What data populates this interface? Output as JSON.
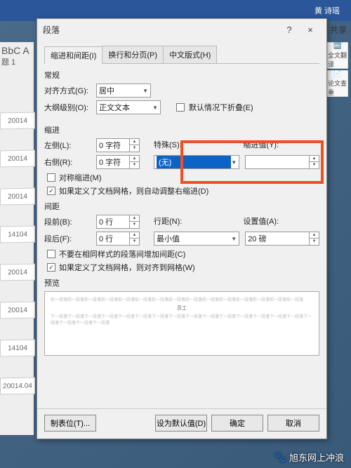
{
  "bg": {
    "user": "黄 诗瑶",
    "share": "共享",
    "left_header": "BbC A",
    "left_sub": "题 1",
    "side_btns": [
      "全文翻译",
      "论文查重"
    ],
    "rows": [
      "20014",
      "20014",
      "20014",
      "14104",
      "20014",
      "20014",
      "14104",
      "20014.04"
    ]
  },
  "dialog": {
    "title": "段落",
    "help": "?",
    "close": "×",
    "tabs": {
      "t1": "缩进和间距(I)",
      "t2": "换行和分页(P)",
      "t3": "中文版式(H)"
    },
    "general": "常规",
    "align_lbl": "对齐方式(G):",
    "align_val": "居中",
    "outline_lbl": "大纲级别(O):",
    "outline_val": "正文文本",
    "collapse_lbl": "默认情况下折叠(E)",
    "indent": "缩进",
    "left_ind_lbl": "左侧(L):",
    "left_ind_val": "0 字符",
    "right_ind_lbl": "右侧(R):",
    "right_ind_val": "0 字符",
    "special_lbl": "特殊(S):",
    "special_val": "(无)",
    "indent_by_lbl": "缩进值(Y):",
    "indent_by_val": "",
    "mirror_lbl": "对称缩进(M)",
    "grid_indent_lbl": "如果定义了文档网格，则自动调整右缩进(D)",
    "spacing": "间距",
    "before_lbl": "段前(B):",
    "before_val": "0 行",
    "after_lbl": "段后(F):",
    "after_val": "0 行",
    "line_lbl": "行距(N):",
    "line_val": "最小值",
    "at_lbl": "设置值(A):",
    "at_val": "20 磅",
    "no_space_lbl": "不要在相同样式的段落间增加间距(C)",
    "snap_grid_lbl": "如果定义了文档网格，则对齐到网格(W)",
    "preview": "预览",
    "preview_mid": "员工",
    "buttons": {
      "tabs": "制表位(T)...",
      "default": "设为默认值(D)",
      "ok": "确定",
      "cancel": "取消"
    }
  },
  "watermark": "旭东网上冲浪"
}
